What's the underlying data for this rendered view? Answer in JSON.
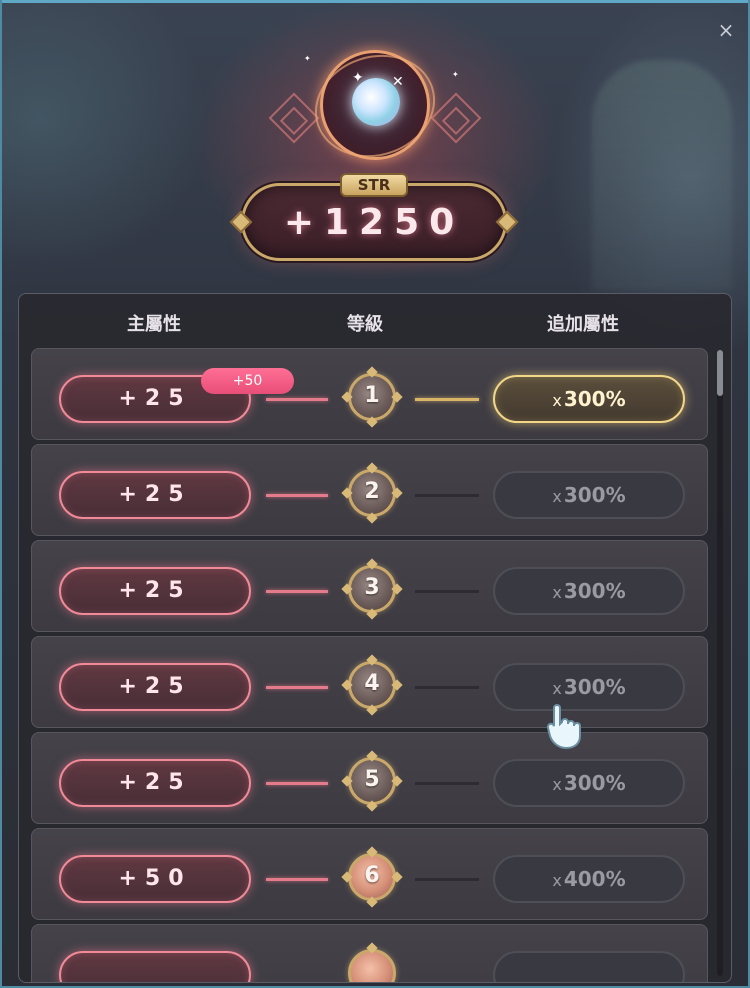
{
  "close_glyph": "×",
  "emblem": {
    "stat_tag": "STR",
    "stat_total": "+1250"
  },
  "table": {
    "headers": {
      "main": "主屬性",
      "level": "等級",
      "bonus": "追加屬性"
    },
    "rows": [
      {
        "main": "+25",
        "level": "1",
        "mult_x": "x",
        "mult_value": "300%",
        "active": true,
        "badge": "+50"
      },
      {
        "main": "+25",
        "level": "2",
        "mult_x": "x",
        "mult_value": "300%",
        "active": false
      },
      {
        "main": "+25",
        "level": "3",
        "mult_x": "x",
        "mult_value": "300%",
        "active": false
      },
      {
        "main": "+25",
        "level": "4",
        "mult_x": "x",
        "mult_value": "300%",
        "active": false
      },
      {
        "main": "+25",
        "level": "5",
        "mult_x": "x",
        "mult_value": "300%",
        "active": false
      },
      {
        "main": "+50",
        "level": "6",
        "mult_x": "x",
        "mult_value": "400%",
        "active": false
      }
    ]
  },
  "colors": {
    "main_border": "#f08a98",
    "active_mult_border": "#f2d789",
    "level_ring": "#c9a86a",
    "badge": "#ff6f95"
  },
  "icons": {
    "close": "close-icon",
    "gem": "gem-icon",
    "cursor": "hand-cursor-icon"
  }
}
